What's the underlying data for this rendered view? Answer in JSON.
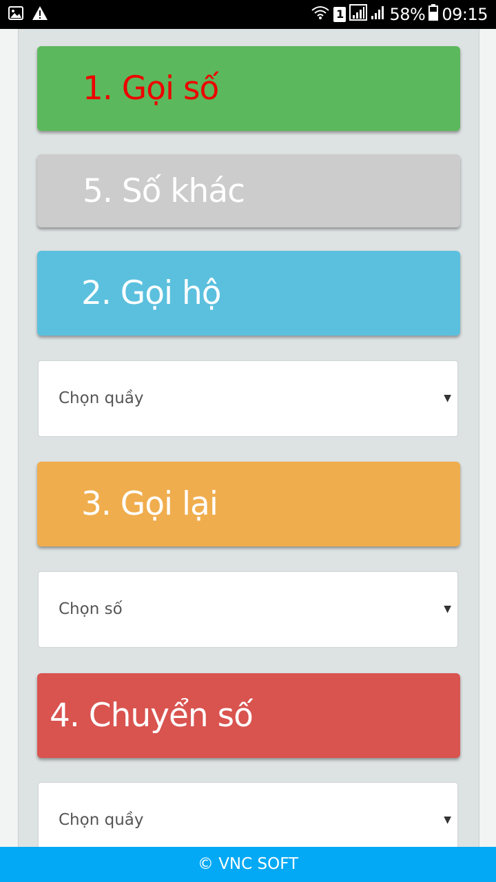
{
  "status_bar": {
    "battery": "58%",
    "time": "09:15",
    "sim_number": "1",
    "icons": [
      "image-icon",
      "warning-icon",
      "wifi-icon",
      "sim-icon",
      "signal-icon",
      "signal-icon-2",
      "battery-icon"
    ]
  },
  "buttons": {
    "call": "1. Gọi số",
    "other": "5. Số khác",
    "proxy": "2. Gọi hộ",
    "recall": "3. Gọi lại",
    "transfer": "4. Chuyển số"
  },
  "selects": {
    "counter_1": "Chọn quầy",
    "number": "Chọn số",
    "counter_2": "Chọn quầy",
    "arrow": "▼"
  },
  "colors": {
    "call_bg": "#5cb85c",
    "call_text": "#ee0000",
    "other_bg": "#cccccc",
    "proxy_bg": "#5bc0de",
    "recall_bg": "#f0ad4e",
    "transfer_bg": "#d9534f",
    "footer_bg": "#03a9f4"
  },
  "footer": {
    "text": "© VNC SOFT"
  }
}
